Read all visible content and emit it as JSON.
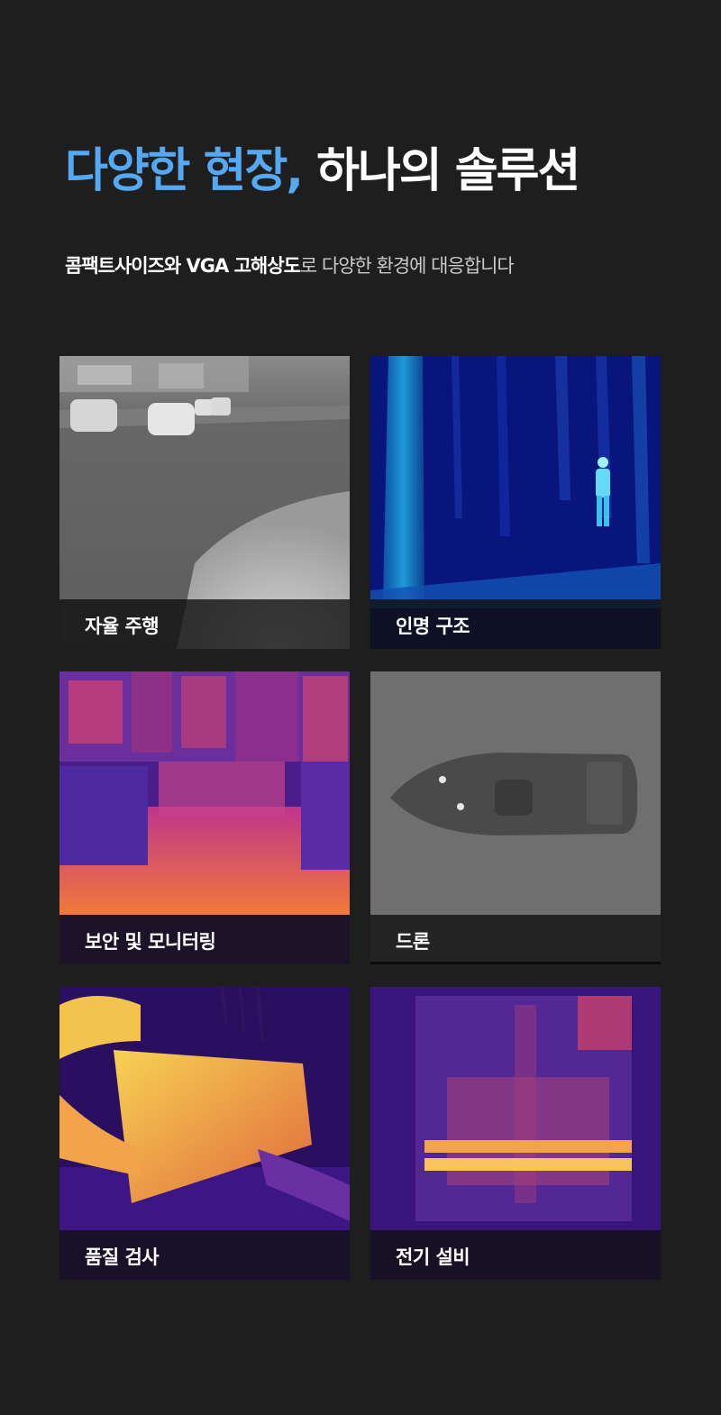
{
  "header": {
    "title_accent": "다양한 현장,",
    "title_rest": " 하나의 솔루션",
    "subtitle_strong": "콤팩트사이즈와 VGA 고해상도",
    "subtitle_rest": "로 다양한 환경에 대응합니다"
  },
  "cards": [
    {
      "label": "자율 주행",
      "image": "thermal-road-image"
    },
    {
      "label": "인명 구조",
      "image": "thermal-forest-person-image"
    },
    {
      "label": "보안 및 모니터링",
      "image": "thermal-city-image"
    },
    {
      "label": "드론",
      "image": "thermal-boat-image"
    },
    {
      "label": "품질 검사",
      "image": "thermal-equipment-image"
    },
    {
      "label": "전기 설비",
      "image": "thermal-electrical-panel-image"
    }
  ],
  "colors": {
    "background": "#1e1e1e",
    "accent": "#55a8f2",
    "text": "#ffffff",
    "subtext": "#c9c9c9"
  }
}
